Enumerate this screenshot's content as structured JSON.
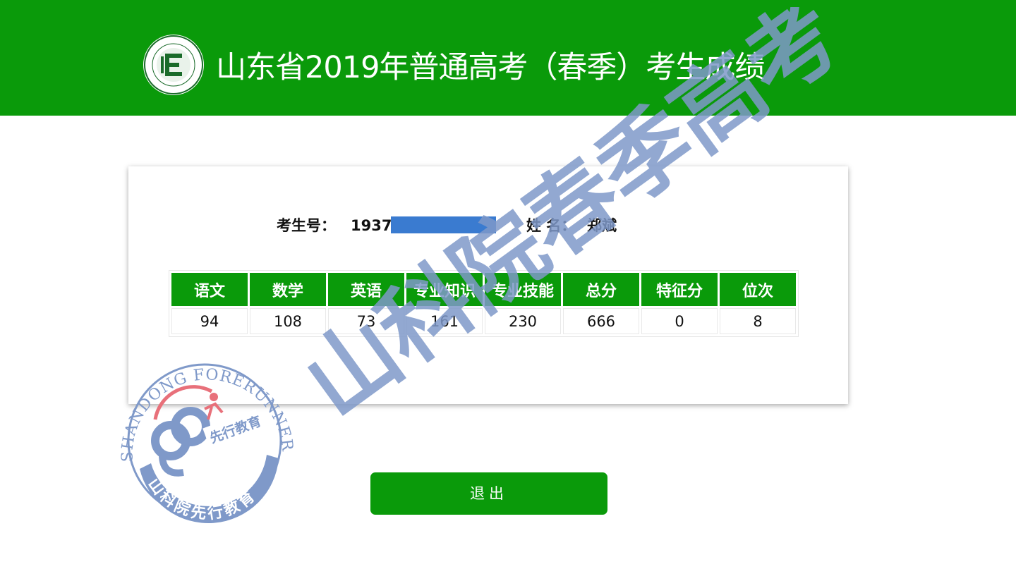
{
  "header": {
    "title": "山东省2019年普通高考（春季）考生成绩",
    "logo_icon": "education-e-logo"
  },
  "candidate": {
    "id_label": "考生号：",
    "id_value": "1937",
    "name_label": "姓 名：",
    "name_value": "郑斌"
  },
  "scores": {
    "headers": [
      "语文",
      "数学",
      "英语",
      "专业知识",
      "专业技能",
      "总分",
      "特征分",
      "位次"
    ],
    "values": [
      "94",
      "108",
      "73",
      "161",
      "230",
      "666",
      "0",
      "8"
    ]
  },
  "actions": {
    "exit_label": "退出"
  },
  "watermark": {
    "text": "山科院春季高考",
    "stamp_ring_text": "SHANDONG FORERUNNER EDUCATION",
    "stamp_brand": "先行教育",
    "stamp_bottom_text": "山科院先行教育"
  },
  "colors": {
    "primary_green": "#0a9a0a",
    "redaction_blue": "#3a7bd0",
    "watermark_blue": "#7f99c9",
    "stamp_pink": "#e8707a"
  }
}
